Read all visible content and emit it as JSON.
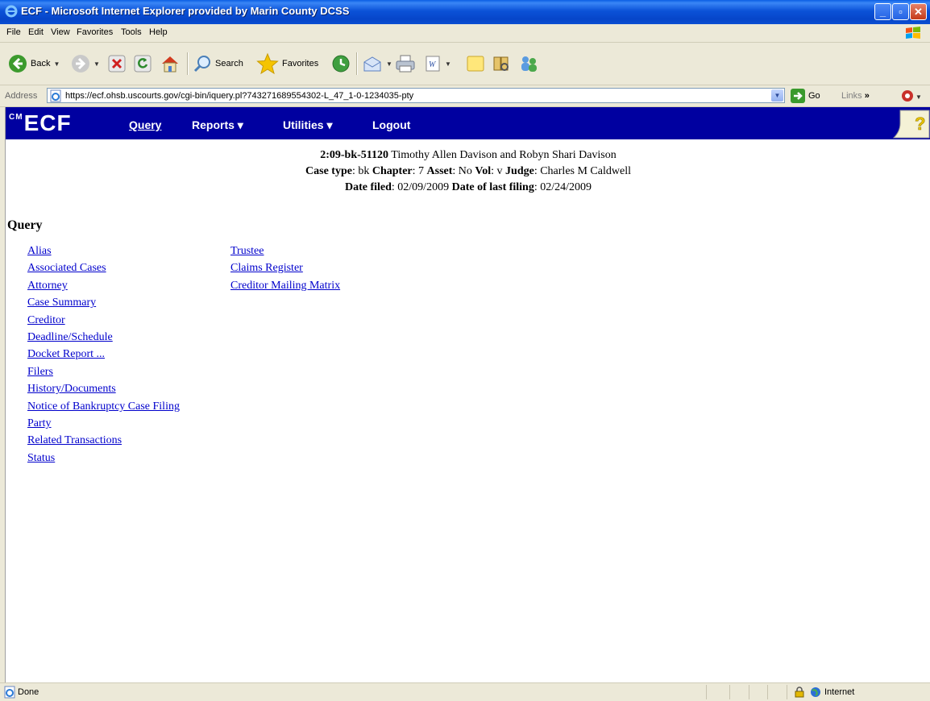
{
  "window": {
    "title": "ECF - Microsoft Internet Explorer provided by Marin County DCSS",
    "minimize": "_",
    "maximize": "▫",
    "close": "✕"
  },
  "menu": [
    "File",
    "Edit",
    "View",
    "Favorites",
    "Tools",
    "Help"
  ],
  "toolbar": {
    "back": "Back",
    "search": "Search",
    "favorites": "Favorites"
  },
  "address": {
    "label": "Address",
    "url": "https://ecf.ohsb.uscourts.gov/cgi-bin/iquery.pl?743271689554302-L_47_1-0-1234035-pty",
    "go": "Go",
    "links": "Links"
  },
  "ecf": {
    "logo": "ECF",
    "logo_prefix": "CM",
    "nav": {
      "query": "Query",
      "reports": "Reports",
      "utilities": "Utilities",
      "logout": "Logout"
    }
  },
  "case": {
    "number": "2:09-bk-51120",
    "parties": "Timothy Allen Davison and Robyn Shari Davison",
    "type_label": "Case type",
    "type": "bk",
    "chapter_label": "Chapter",
    "chapter": "7",
    "asset_label": "Asset",
    "asset": "No",
    "vol_label": "Vol",
    "vol": "v",
    "judge_label": "Judge",
    "judge": "Charles M Caldwell",
    "filed_label": "Date filed",
    "filed": "02/09/2009",
    "last_label": "Date of last filing",
    "last": "02/24/2009"
  },
  "query": {
    "heading": "Query",
    "left_links": [
      "Alias",
      "Associated Cases",
      "Attorney",
      "Case Summary",
      "Creditor",
      "Deadline/Schedule",
      "Docket Report ...",
      "Filers",
      "History/Documents",
      "Notice of Bankruptcy Case Filing",
      "Party",
      "Related Transactions",
      "Status"
    ],
    "right_links": [
      "Trustee",
      "Claims Register",
      "Creditor Mailing Matrix"
    ]
  },
  "status": {
    "done": "Done",
    "zone": "Internet"
  }
}
